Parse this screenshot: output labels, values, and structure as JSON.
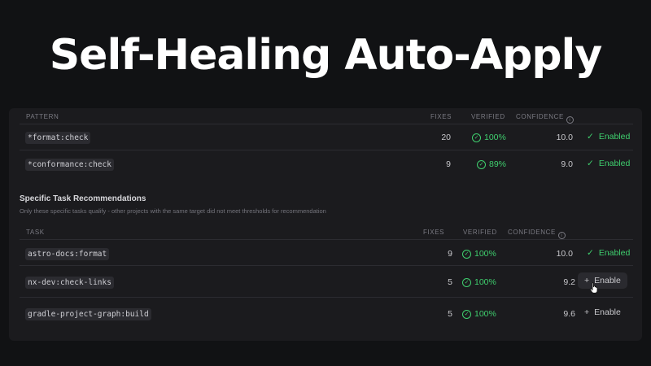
{
  "hero": {
    "title": "Self-Healing Auto-Apply"
  },
  "pattern_table": {
    "headers": {
      "pattern": "PATTERN",
      "fixes": "FIXES",
      "verified": "VERIFIED",
      "confidence": "CONFIDENCE"
    },
    "rows": [
      {
        "name": "*format:check",
        "fixes": "20",
        "verified": "100%",
        "confidence": "10.0",
        "action": "Enabled"
      },
      {
        "name": "*conformance:check",
        "fixes": "9",
        "verified": "89%",
        "confidence": "9.0",
        "action": "Enabled"
      }
    ]
  },
  "task_section": {
    "title": "Specific Task Recommendations",
    "subtitle": "Only these specific tasks qualify - other projects with the same target did not meet thresholds for recommendation",
    "headers": {
      "task": "TASK",
      "fixes": "FIXES",
      "verified": "VERIFIED",
      "confidence": "CONFIDENCE"
    },
    "rows": [
      {
        "name": "astro-docs:format",
        "fixes": "9",
        "verified": "100%",
        "confidence": "10.0",
        "action": "Enabled"
      },
      {
        "name": "nx-dev:check-links",
        "fixes": "5",
        "verified": "100%",
        "confidence": "9.2",
        "action": "Enable"
      },
      {
        "name": "gradle-project-graph:build",
        "fixes": "5",
        "verified": "100%",
        "confidence": "9.6",
        "action": "Enable"
      }
    ]
  },
  "icons": {
    "check": "check-icon",
    "check_circle": "check-circle-icon",
    "plus": "plus-icon",
    "info": "info-icon",
    "cursor": "hand-pointer-icon"
  },
  "colors": {
    "background": "#111214",
    "panel": "#1b1b1e",
    "accent_green": "#3fcf6e"
  }
}
